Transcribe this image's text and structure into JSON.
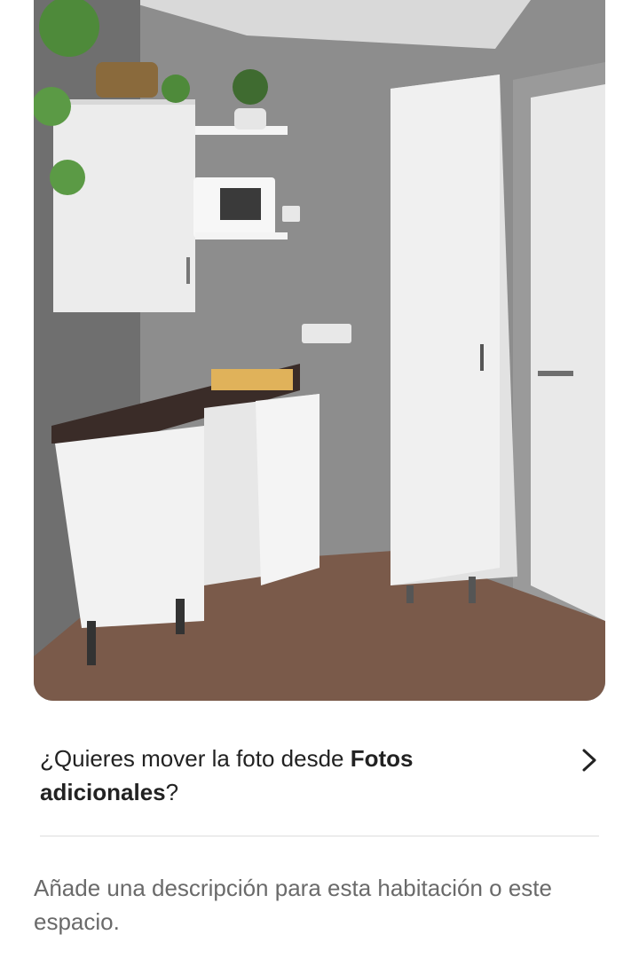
{
  "photo": {
    "subject": "kitchenette-photo",
    "icon": "room-photo"
  },
  "move_prompt": {
    "prefix": "¿Quieres mover la foto desde ",
    "bold": "Fotos adicionales",
    "suffix": "?",
    "icon": "chevron-right-icon"
  },
  "description_placeholder": "Añade una descripción para esta habitación o este espacio.",
  "colors": {
    "text_primary": "#222222",
    "text_secondary": "#6a6a6a",
    "divider": "#dddddd"
  }
}
